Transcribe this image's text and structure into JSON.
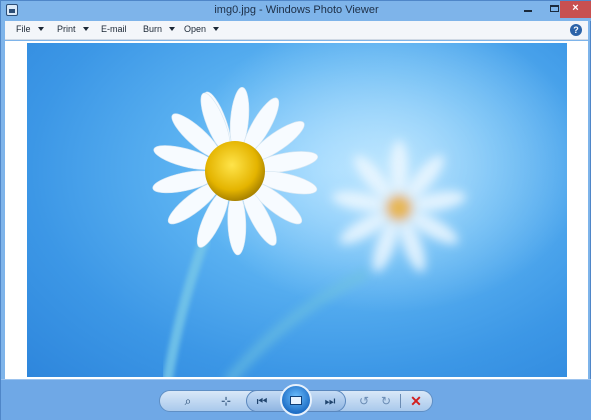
{
  "window": {
    "title": "img0.jpg - Windows Photo Viewer",
    "close_label": "×"
  },
  "menu": {
    "file": "File",
    "print": "Print",
    "email": "E-mail",
    "burn": "Burn",
    "open": "Open",
    "help": "?"
  },
  "controls": {
    "zoom": "⌕",
    "actual_size": "⊹",
    "previous": "⏮",
    "next": "⏭",
    "rotate_left": "↺",
    "rotate_right": "↻",
    "delete": "✕"
  },
  "colors": {
    "frame": "#7eb4ea",
    "photo_sky": "#3c97e6",
    "delete_red": "#d21f1f"
  },
  "icons": [
    "app-icon",
    "help-icon",
    "zoom-icon",
    "actual-size-icon",
    "previous-icon",
    "slideshow-icon",
    "next-icon",
    "rotate-left-icon",
    "rotate-right-icon",
    "delete-icon"
  ]
}
